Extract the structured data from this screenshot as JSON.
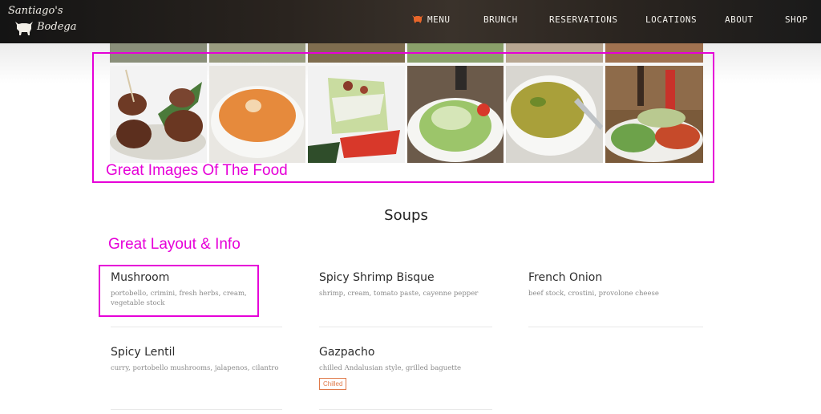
{
  "logo": {
    "line1": "Santiago's",
    "line2": "Bodega"
  },
  "nav": [
    {
      "label": "MENU",
      "icon": "bull-icon"
    },
    {
      "label": "BRUNCH"
    },
    {
      "label": "RESERVATIONS"
    },
    {
      "label": "LOCATIONS"
    },
    {
      "label": "ABOUT"
    },
    {
      "label": "SHOP"
    }
  ],
  "annotations": {
    "images": "Great Images Of The Food",
    "layout": "Great Layout & Info"
  },
  "section": {
    "title": "Soups"
  },
  "items": [
    {
      "name": "Mushroom",
      "desc": "portobello, crimini, fresh herbs, cream, vegetable stock"
    },
    {
      "name": "Spicy Shrimp Bisque",
      "desc": "shrimp, cream, tomato paste, cayenne pepper"
    },
    {
      "name": "French Onion",
      "desc": "beef stock, crostini, provolone cheese"
    },
    {
      "name": "Spicy Lentil",
      "desc": "curry, portobello mushrooms, jalapenos, cilantro"
    },
    {
      "name": "Gazpacho",
      "desc": "chilled Andalusian style, grilled baguette",
      "badge": "Chilled"
    }
  ],
  "colors": {
    "annotation": "#e600d8",
    "badge": "#e07a4a",
    "header": "#2a241f"
  }
}
